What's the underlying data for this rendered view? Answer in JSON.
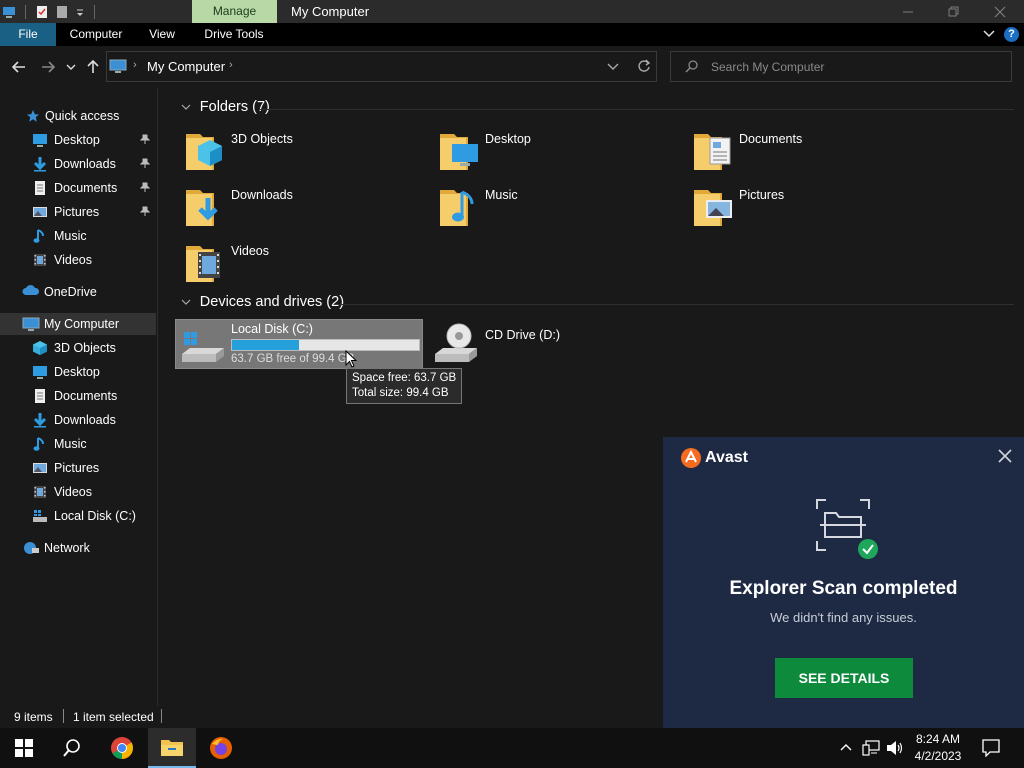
{
  "window": {
    "manage_tab": "Manage",
    "title": "My Computer"
  },
  "ribbon": {
    "tabs": [
      "File",
      "Computer",
      "View",
      "Drive Tools"
    ]
  },
  "address": {
    "crumb": "My Computer",
    "search_placeholder": "Search My Computer"
  },
  "nav": {
    "quick_access": "Quick access",
    "quick_items": [
      {
        "label": "Desktop",
        "icon": "desktop-icon",
        "pinned": true
      },
      {
        "label": "Downloads",
        "icon": "downloads-icon",
        "pinned": true
      },
      {
        "label": "Documents",
        "icon": "documents-icon",
        "pinned": true
      },
      {
        "label": "Pictures",
        "icon": "pictures-icon",
        "pinned": true
      },
      {
        "label": "Music",
        "icon": "music-icon",
        "pinned": false
      },
      {
        "label": "Videos",
        "icon": "videos-icon",
        "pinned": false
      }
    ],
    "onedrive": "OneDrive",
    "my_computer": "My Computer",
    "computer_items": [
      {
        "label": "3D Objects",
        "icon": "3d-objects-icon"
      },
      {
        "label": "Desktop",
        "icon": "desktop-icon"
      },
      {
        "label": "Documents",
        "icon": "documents-icon"
      },
      {
        "label": "Downloads",
        "icon": "downloads-icon"
      },
      {
        "label": "Music",
        "icon": "music-icon"
      },
      {
        "label": "Pictures",
        "icon": "pictures-icon"
      },
      {
        "label": "Videos",
        "icon": "videos-icon"
      },
      {
        "label": "Local Disk (C:)",
        "icon": "local-disk-icon"
      }
    ],
    "network": "Network"
  },
  "content": {
    "folders_header": "Folders (7)",
    "folders": [
      {
        "label": "3D Objects",
        "icon": "3d-objects-icon"
      },
      {
        "label": "Desktop",
        "icon": "desktop-icon"
      },
      {
        "label": "Documents",
        "icon": "documents-icon"
      },
      {
        "label": "Downloads",
        "icon": "downloads-icon"
      },
      {
        "label": "Music",
        "icon": "music-icon"
      },
      {
        "label": "Pictures",
        "icon": "pictures-icon"
      },
      {
        "label": "Videos",
        "icon": "videos-icon"
      }
    ],
    "devices_header": "Devices and drives (2)",
    "drive_c": {
      "label": "Local Disk (C:)",
      "free_text": "63.7 GB free of 99.4 GB",
      "used_fraction": 0.359
    },
    "drive_d": {
      "label": "CD Drive (D:)"
    },
    "tooltip": {
      "line1": "Space free: 63.7 GB",
      "line2": "Total size: 99.4 GB"
    }
  },
  "status": {
    "items": "9 items",
    "selected": "1 item selected"
  },
  "avast": {
    "brand": "Avast",
    "title": "Explorer Scan completed",
    "subtitle": "We didn't find any issues.",
    "button": "SEE DETAILS",
    "accent": "#0e8a3c"
  },
  "taskbar": {
    "time": "8:24 AM",
    "date": "4/2/2023"
  }
}
